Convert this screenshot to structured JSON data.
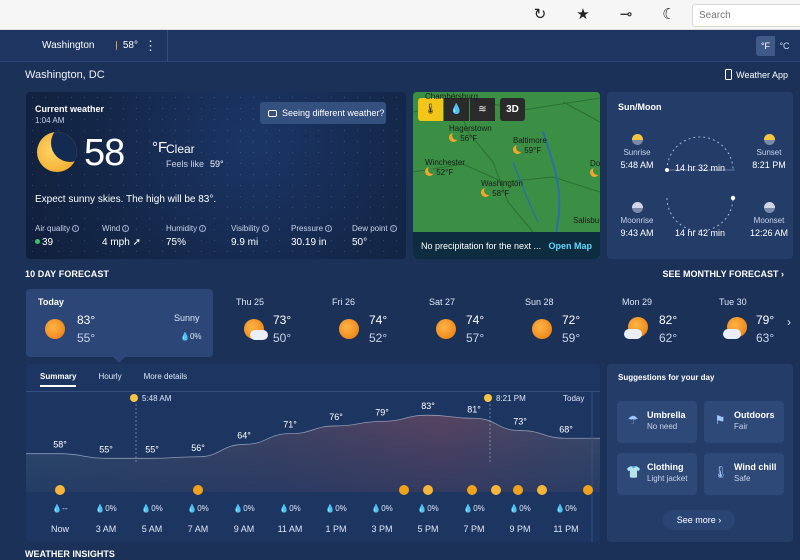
{
  "browser": {
    "search_placeholder": "Search"
  },
  "header": {
    "location_chip": "Washington",
    "chip_temp": "58°",
    "unit_f": "°F",
    "unit_c": "°C",
    "city": "Washington, DC",
    "app_link": "Weather App"
  },
  "current": {
    "title": "Current weather",
    "time": "1:04 AM",
    "temp": "58",
    "unit": "°F",
    "condition": "Clear",
    "feels_label": "Feels like",
    "feels_value": "59°",
    "description": "Expect sunny skies. The high will be 83°.",
    "seeing_label": "Seeing different weather?",
    "metrics": [
      {
        "label": "Air quality",
        "value": "39"
      },
      {
        "label": "Wind",
        "value": "4 mph"
      },
      {
        "label": "Humidity",
        "value": "75%"
      },
      {
        "label": "Visibility",
        "value": "9.9 mi"
      },
      {
        "label": "Pressure",
        "value": "30.19 in"
      },
      {
        "label": "Dew point",
        "value": "50°"
      }
    ]
  },
  "map": {
    "mode_3d": "3D",
    "cities": [
      {
        "name": "Chambersburg",
        "temp": ""
      },
      {
        "name": "Hagerstown",
        "temp": "56°F"
      },
      {
        "name": "Baltimore",
        "temp": "59°F"
      },
      {
        "name": "Winchester",
        "temp": "52°F"
      },
      {
        "name": "Washington",
        "temp": "58°F"
      },
      {
        "name": "Do",
        "temp": ""
      },
      {
        "name": "Salisbu",
        "temp": ""
      }
    ],
    "footer_text": "No precipitation for the next ...",
    "open_map": "Open Map"
  },
  "sunmoon": {
    "title": "Sun/Moon",
    "sunrise_label": "Sunrise",
    "sunrise": "5:48 AM",
    "sunset_label": "Sunset",
    "sunset": "8:21 PM",
    "sun_duration": "14 hr 32 min",
    "moonrise_label": "Moonrise",
    "moonrise": "9:43 AM",
    "moonset_label": "Moonset",
    "moonset": "12:26 AM",
    "moon_duration": "14 hr 42 min"
  },
  "forecast": {
    "title": "10 DAY FORECAST",
    "monthly_link": "SEE MONTHLY FORECAST",
    "days": [
      {
        "name": "Today",
        "hi": "83°",
        "lo": "55°",
        "cond": "Sunny",
        "precip": "0%",
        "icon": "sun-icon"
      },
      {
        "name": "Thu 25",
        "hi": "73°",
        "lo": "50°",
        "icon": "partly-sunny-icon"
      },
      {
        "name": "Fri 26",
        "hi": "74°",
        "lo": "52°",
        "icon": "sun-icon"
      },
      {
        "name": "Sat 27",
        "hi": "74°",
        "lo": "57°",
        "icon": "sun-icon"
      },
      {
        "name": "Sun 28",
        "hi": "72°",
        "lo": "59°",
        "icon": "sun-icon"
      },
      {
        "name": "Mon 29",
        "hi": "82°",
        "lo": "62°",
        "icon": "partly-cloudy-icon"
      },
      {
        "name": "Tue 30",
        "hi": "79°",
        "lo": "63°",
        "icon": "partly-cloudy-icon"
      }
    ]
  },
  "hourly": {
    "tabs": [
      "Summary",
      "Hourly",
      "More details"
    ],
    "sunrise_marker": "5:48 AM",
    "sunset_marker": "8:21 PM",
    "today_label": "Today",
    "hours": [
      "Now",
      "3 AM",
      "5 AM",
      "7 AM",
      "9 AM",
      "11 AM",
      "1 PM",
      "3 PM",
      "5 PM",
      "7 PM",
      "9 PM",
      "11 PM"
    ],
    "temps": [
      58,
      55,
      55,
      56,
      64,
      71,
      76,
      79,
      83,
      81,
      73,
      68
    ],
    "precip": [
      "--",
      "0%",
      "0%",
      "0%",
      "0%",
      "0%",
      "0%",
      "0%",
      "0%",
      "0%",
      "0%",
      "0%"
    ]
  },
  "suggestions": {
    "title": "Suggestions for your day",
    "tiles": [
      {
        "title": "Umbrella",
        "sub": "No need",
        "icon": "umbrella-icon"
      },
      {
        "title": "Outdoors",
        "sub": "Fair",
        "icon": "running-icon"
      },
      {
        "title": "Clothing",
        "sub": "Light jacket",
        "icon": "shirt-icon"
      },
      {
        "title": "Wind chill",
        "sub": "Safe",
        "icon": "thermometer-icon"
      }
    ],
    "see_more": "See more"
  },
  "insights_title": "WEATHER INSIGHTS",
  "colors": {
    "background": "#1b3158",
    "card": "#243d68",
    "accent_sun": "#f0a21a",
    "map_green": "#3a8f44",
    "link_cyan": "#5fd8ff"
  }
}
